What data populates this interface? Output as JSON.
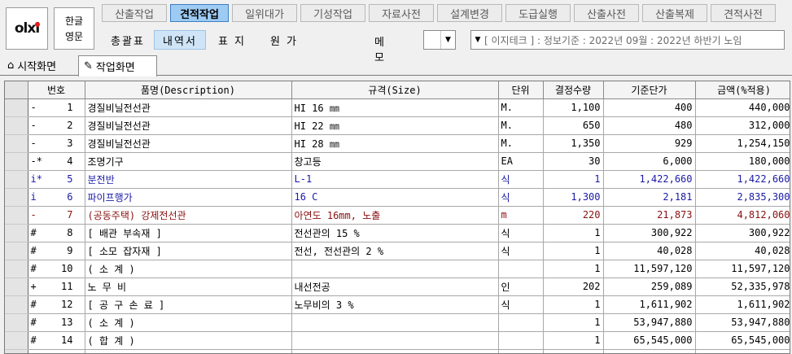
{
  "logo": {
    "text": "olxi"
  },
  "lang": {
    "top": "한글",
    "bottom": "영문"
  },
  "tabs": [
    {
      "label": "산출작업",
      "active": false
    },
    {
      "label": "견적작업",
      "active": true
    },
    {
      "label": "일위대가",
      "active": false
    },
    {
      "label": "기성작업",
      "active": false
    },
    {
      "label": "자료사전",
      "active": false
    },
    {
      "label": "설계변경",
      "active": false
    },
    {
      "label": "도급실행",
      "active": false
    },
    {
      "label": "산출사전",
      "active": false
    },
    {
      "label": "산출복제",
      "active": false
    },
    {
      "label": "견적사전",
      "active": false
    }
  ],
  "subtabs": [
    {
      "label": "총괄표",
      "active": false
    },
    {
      "label": "내역서",
      "active": true
    },
    {
      "label": "표 지",
      "active": false
    },
    {
      "label": "원 가",
      "active": false
    }
  ],
  "memo": {
    "label": "메모"
  },
  "info": {
    "text": "[ 이지테크 ] : 정보기준 : 2022년 09월 : 2022년 하반기 노임"
  },
  "nav": {
    "home": "시작화면",
    "work": "작업화면"
  },
  "columns": [
    "번호",
    "품명(Description)",
    "규격(Size)",
    "단위",
    "결정수량",
    "기준단가",
    "금액(%적용)"
  ],
  "rows": [
    {
      "type": "-",
      "no": "1",
      "name": "경질비닐전선관",
      "size": "HI 16 ㎜",
      "unit": "M.",
      "qty": "1,100",
      "price": "400",
      "amount": "440,000",
      "color": "black"
    },
    {
      "type": "-",
      "no": "2",
      "name": "경질비닐전선관",
      "size": "HI 22 ㎜",
      "unit": "M.",
      "qty": "650",
      "price": "480",
      "amount": "312,000",
      "color": "black"
    },
    {
      "type": "-",
      "no": "3",
      "name": "경질비닐전선관",
      "size": "HI 28 ㎜",
      "unit": "M.",
      "qty": "1,350",
      "price": "929",
      "amount": "1,254,150",
      "color": "black"
    },
    {
      "type": "-*",
      "no": "4",
      "name": "조명기구",
      "size": "창고등",
      "unit": "EA",
      "qty": "30",
      "price": "6,000",
      "amount": "180,000",
      "color": "black"
    },
    {
      "type": "i*",
      "no": "5",
      "name": "분전반",
      "size": "L-1",
      "unit": "식",
      "qty": "1",
      "price": "1,422,660",
      "amount": "1,422,660",
      "color": "blue"
    },
    {
      "type": "i",
      "no": "6",
      "name": "파이프행가",
      "size": "16 C",
      "unit": "식",
      "qty": "1,300",
      "price": "2,181",
      "amount": "2,835,300",
      "color": "blue"
    },
    {
      "type": "-",
      "no": "7",
      "name": "(공동주택) 강제전선관",
      "size": "아연도 16mm, 노출",
      "unit": "m",
      "qty": "220",
      "price": "21,873",
      "amount": "4,812,060",
      "color": "maroon"
    },
    {
      "type": "#",
      "no": "8",
      "name": "[ 배관 부속재 ]",
      "size": "전선관의 15 %",
      "unit": "식",
      "qty": "1",
      "price": "300,922",
      "amount": "300,922",
      "color": "black"
    },
    {
      "type": "#",
      "no": "9",
      "name": "[ 소모 잡자재 ]",
      "size": "전선, 전선관의 2 %",
      "unit": "식",
      "qty": "1",
      "price": "40,028",
      "amount": "40,028",
      "color": "black"
    },
    {
      "type": "#",
      "no": "10",
      "name": "( 소      계 )",
      "size": "",
      "unit": "",
      "qty": "1",
      "price": "11,597,120",
      "amount": "11,597,120",
      "color": "black"
    },
    {
      "type": "+",
      "no": "11",
      "name": "노 무 비",
      "size": "내선전공",
      "unit": "인",
      "qty": "202",
      "price": "259,089",
      "amount": "52,335,978",
      "color": "black"
    },
    {
      "type": "#",
      "no": "12",
      "name": "[ 공 구 손 료 ]",
      "size": "노무비의 3 %",
      "unit": "식",
      "qty": "1",
      "price": "1,611,902",
      "amount": "1,611,902",
      "color": "black"
    },
    {
      "type": "#",
      "no": "13",
      "name": "( 소      계 )",
      "size": "",
      "unit": "",
      "qty": "1",
      "price": "53,947,880",
      "amount": "53,947,880",
      "color": "black"
    },
    {
      "type": "#",
      "no": "14",
      "name": "( 합      계 )",
      "size": "",
      "unit": "",
      "qty": "1",
      "price": "65,545,000",
      "amount": "65,545,000",
      "color": "black"
    }
  ]
}
